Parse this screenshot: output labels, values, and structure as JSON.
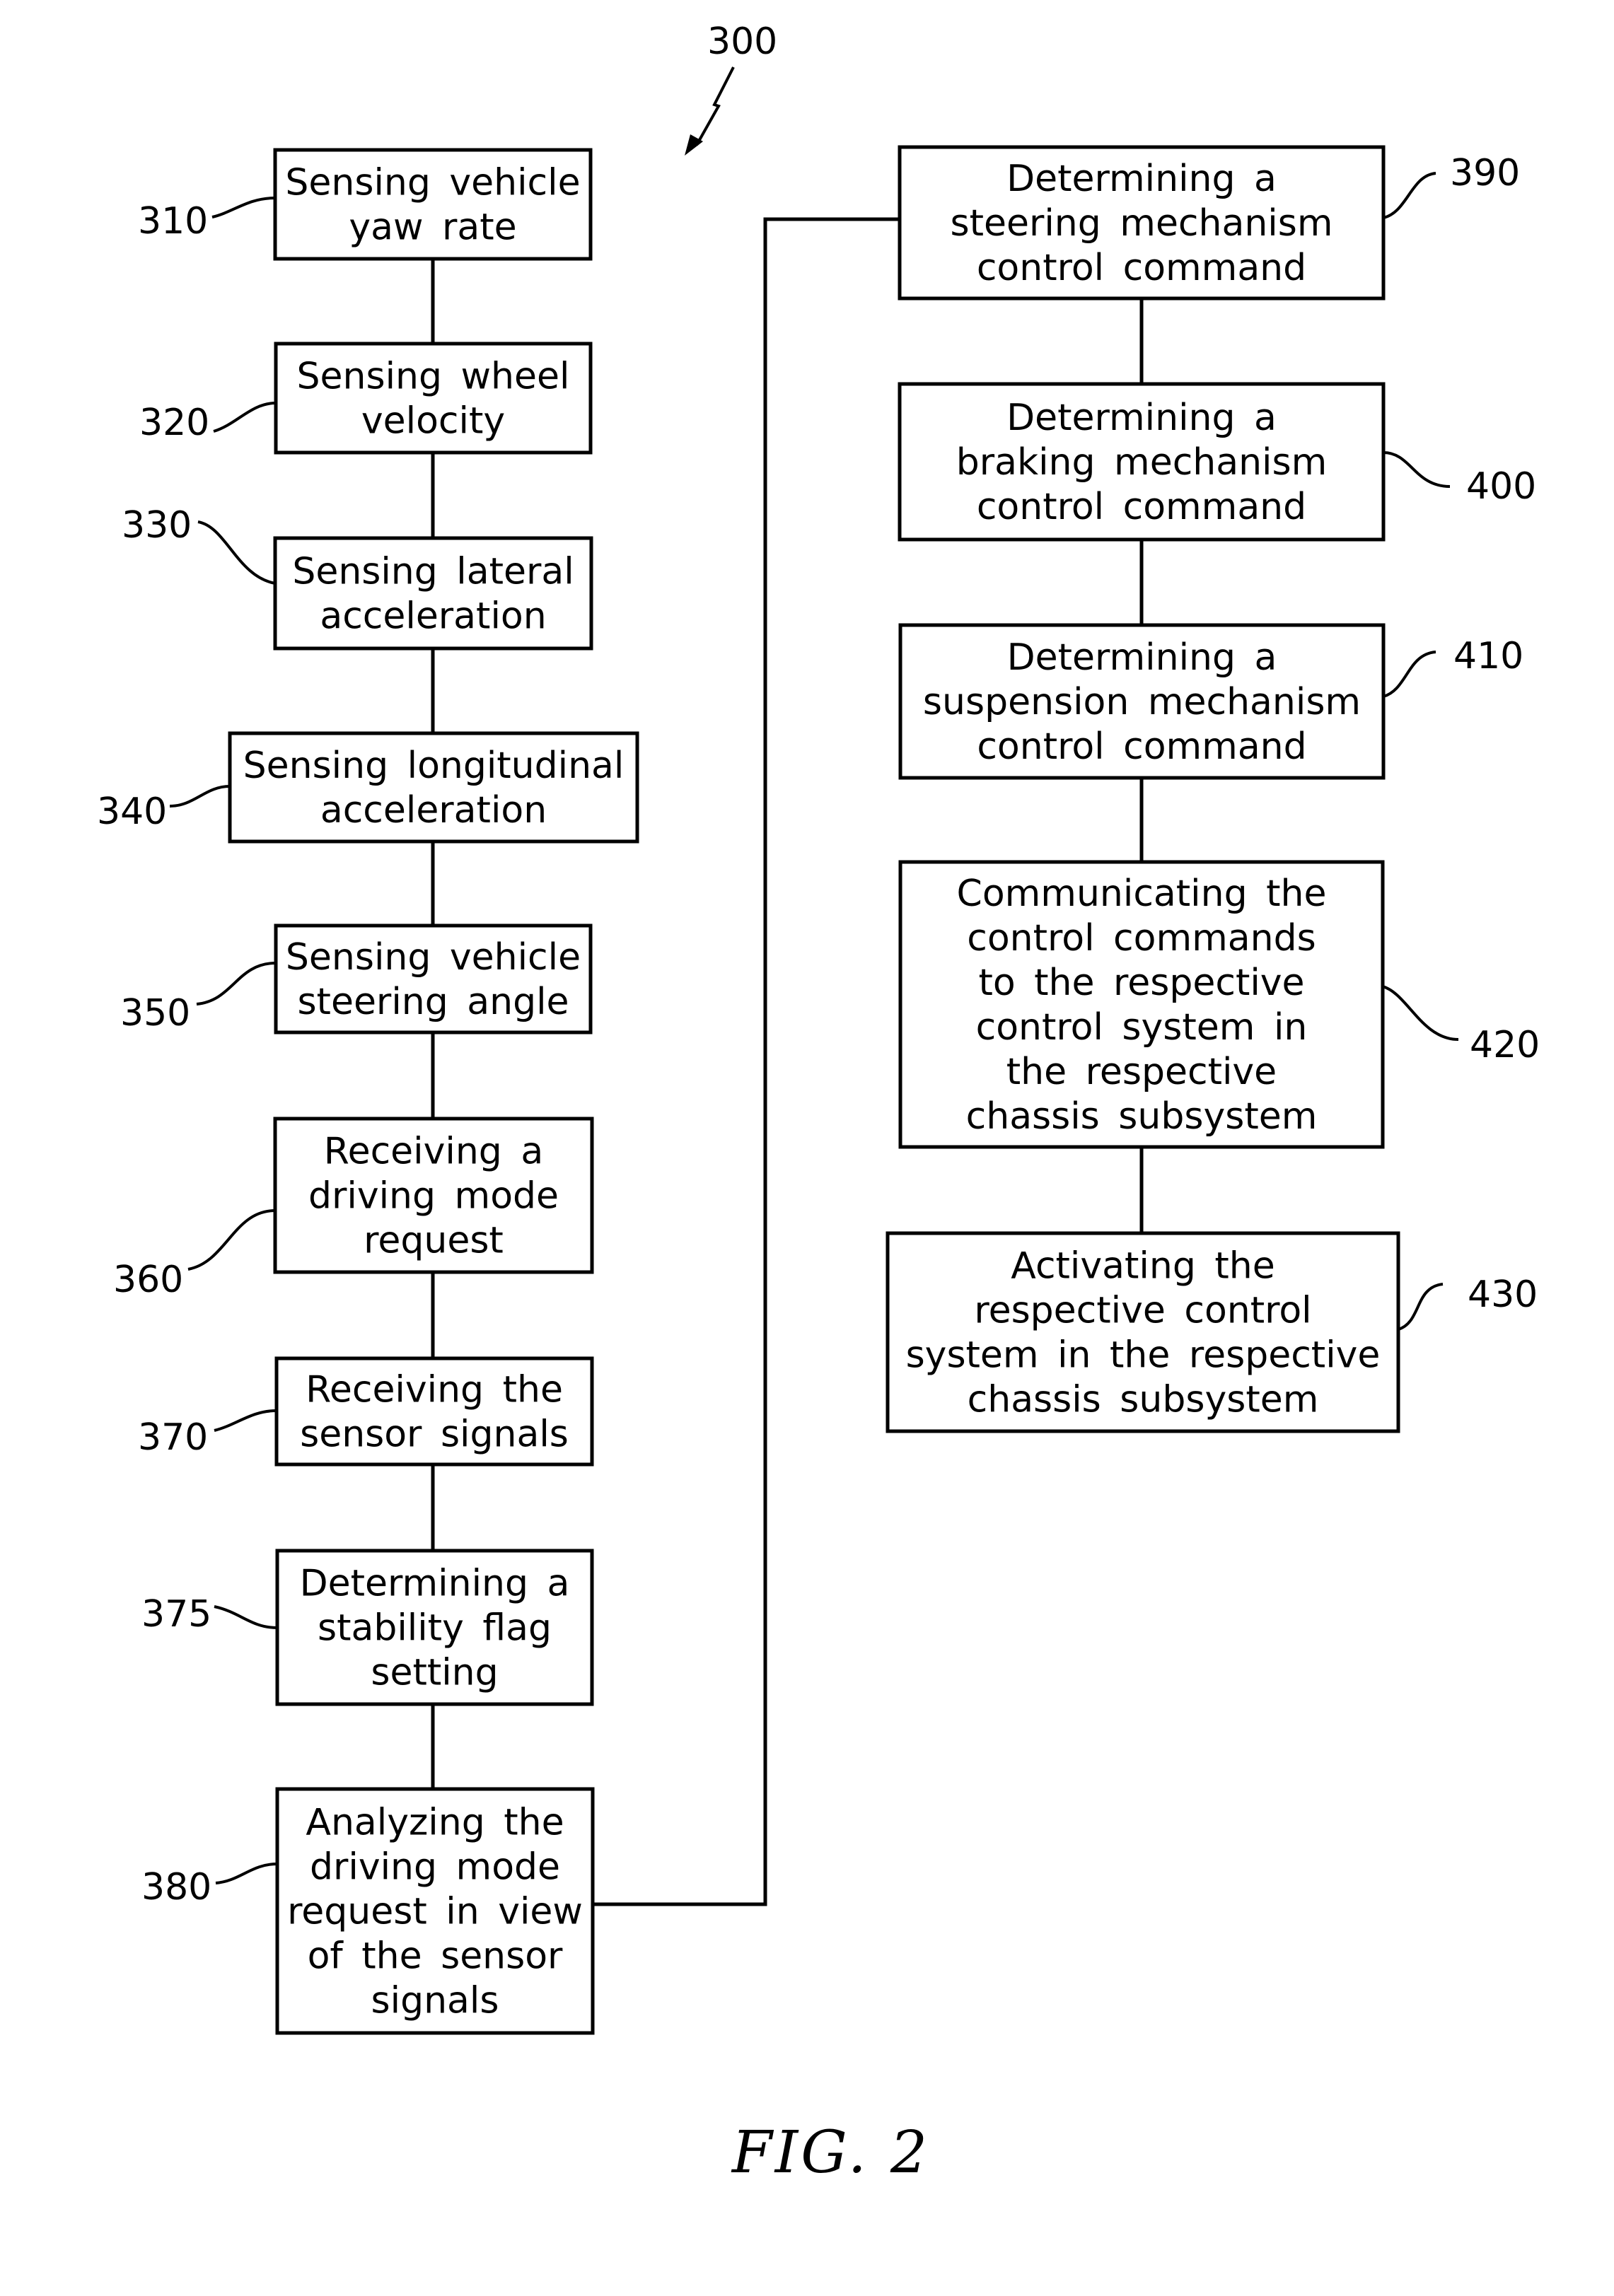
{
  "figure": {
    "caption": "FIG. 2",
    "reference": "300"
  },
  "steps": [
    {
      "ref": "310",
      "lines": [
        "Sensing vehicle",
        "yaw rate"
      ]
    },
    {
      "ref": "320",
      "lines": [
        "Sensing wheel",
        "velocity"
      ]
    },
    {
      "ref": "330",
      "lines": [
        "Sensing lateral",
        "acceleration"
      ]
    },
    {
      "ref": "340",
      "lines": [
        "Sensing longitudinal",
        "acceleration"
      ]
    },
    {
      "ref": "350",
      "lines": [
        "Sensing vehicle",
        "steering angle"
      ]
    },
    {
      "ref": "360",
      "lines": [
        "Receiving a",
        "driving mode",
        "request"
      ]
    },
    {
      "ref": "370",
      "lines": [
        "Receiving the",
        "sensor signals"
      ]
    },
    {
      "ref": "375",
      "lines": [
        "Determining a",
        "stability flag",
        "setting"
      ]
    },
    {
      "ref": "380",
      "lines": [
        "Analyzing the",
        "driving mode",
        "request in view",
        "of the sensor",
        "signals"
      ]
    },
    {
      "ref": "390",
      "lines": [
        "Determining a",
        "steering mechanism",
        "control command"
      ]
    },
    {
      "ref": "400",
      "lines": [
        "Determining a",
        "braking mechanism",
        "control command"
      ]
    },
    {
      "ref": "410",
      "lines": [
        "Determining a",
        "suspension mechanism",
        "control command"
      ]
    },
    {
      "ref": "420",
      "lines": [
        "Communicating the",
        "control commands",
        "to the respective",
        "control system in",
        "the respective",
        "chassis subsystem"
      ]
    },
    {
      "ref": "430",
      "lines": [
        "Activating the",
        "respective control",
        "system in the respective",
        "chassis subsystem"
      ]
    }
  ]
}
